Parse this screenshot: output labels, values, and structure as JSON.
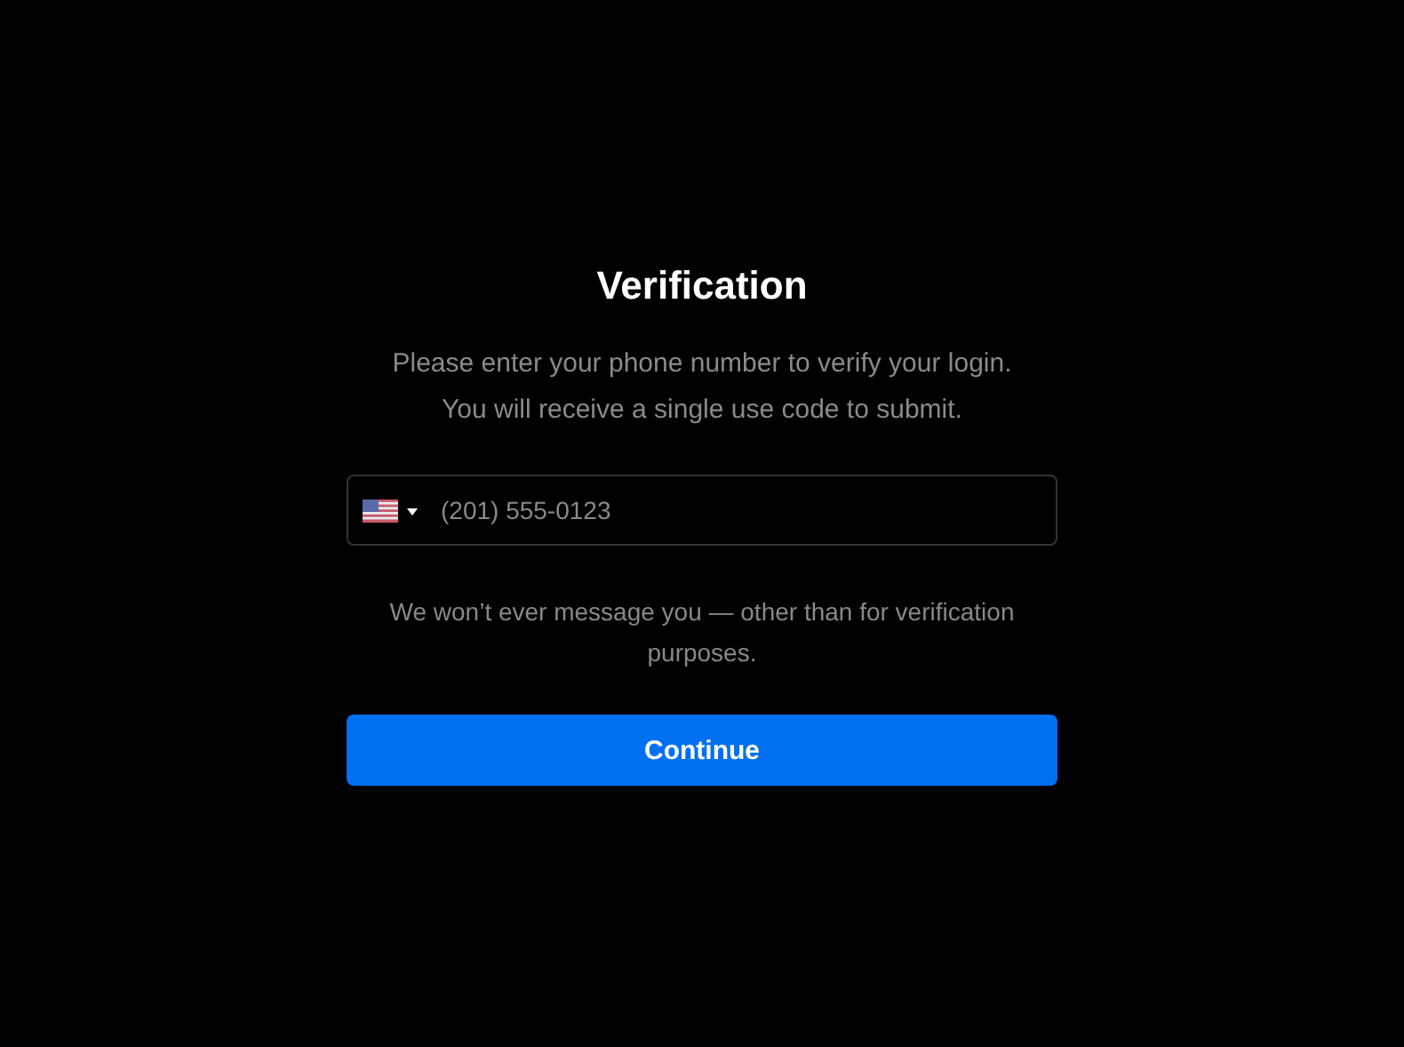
{
  "title": "Verification",
  "description": [
    "Please enter your phone number to verify your login.",
    "You will receive a single use code to submit."
  ],
  "phone_field": {
    "placeholder": "(201) 555-0123"
  },
  "note": "We won’t ever message you — other than for verification purposes.",
  "buttons": [
    "Continue"
  ]
}
